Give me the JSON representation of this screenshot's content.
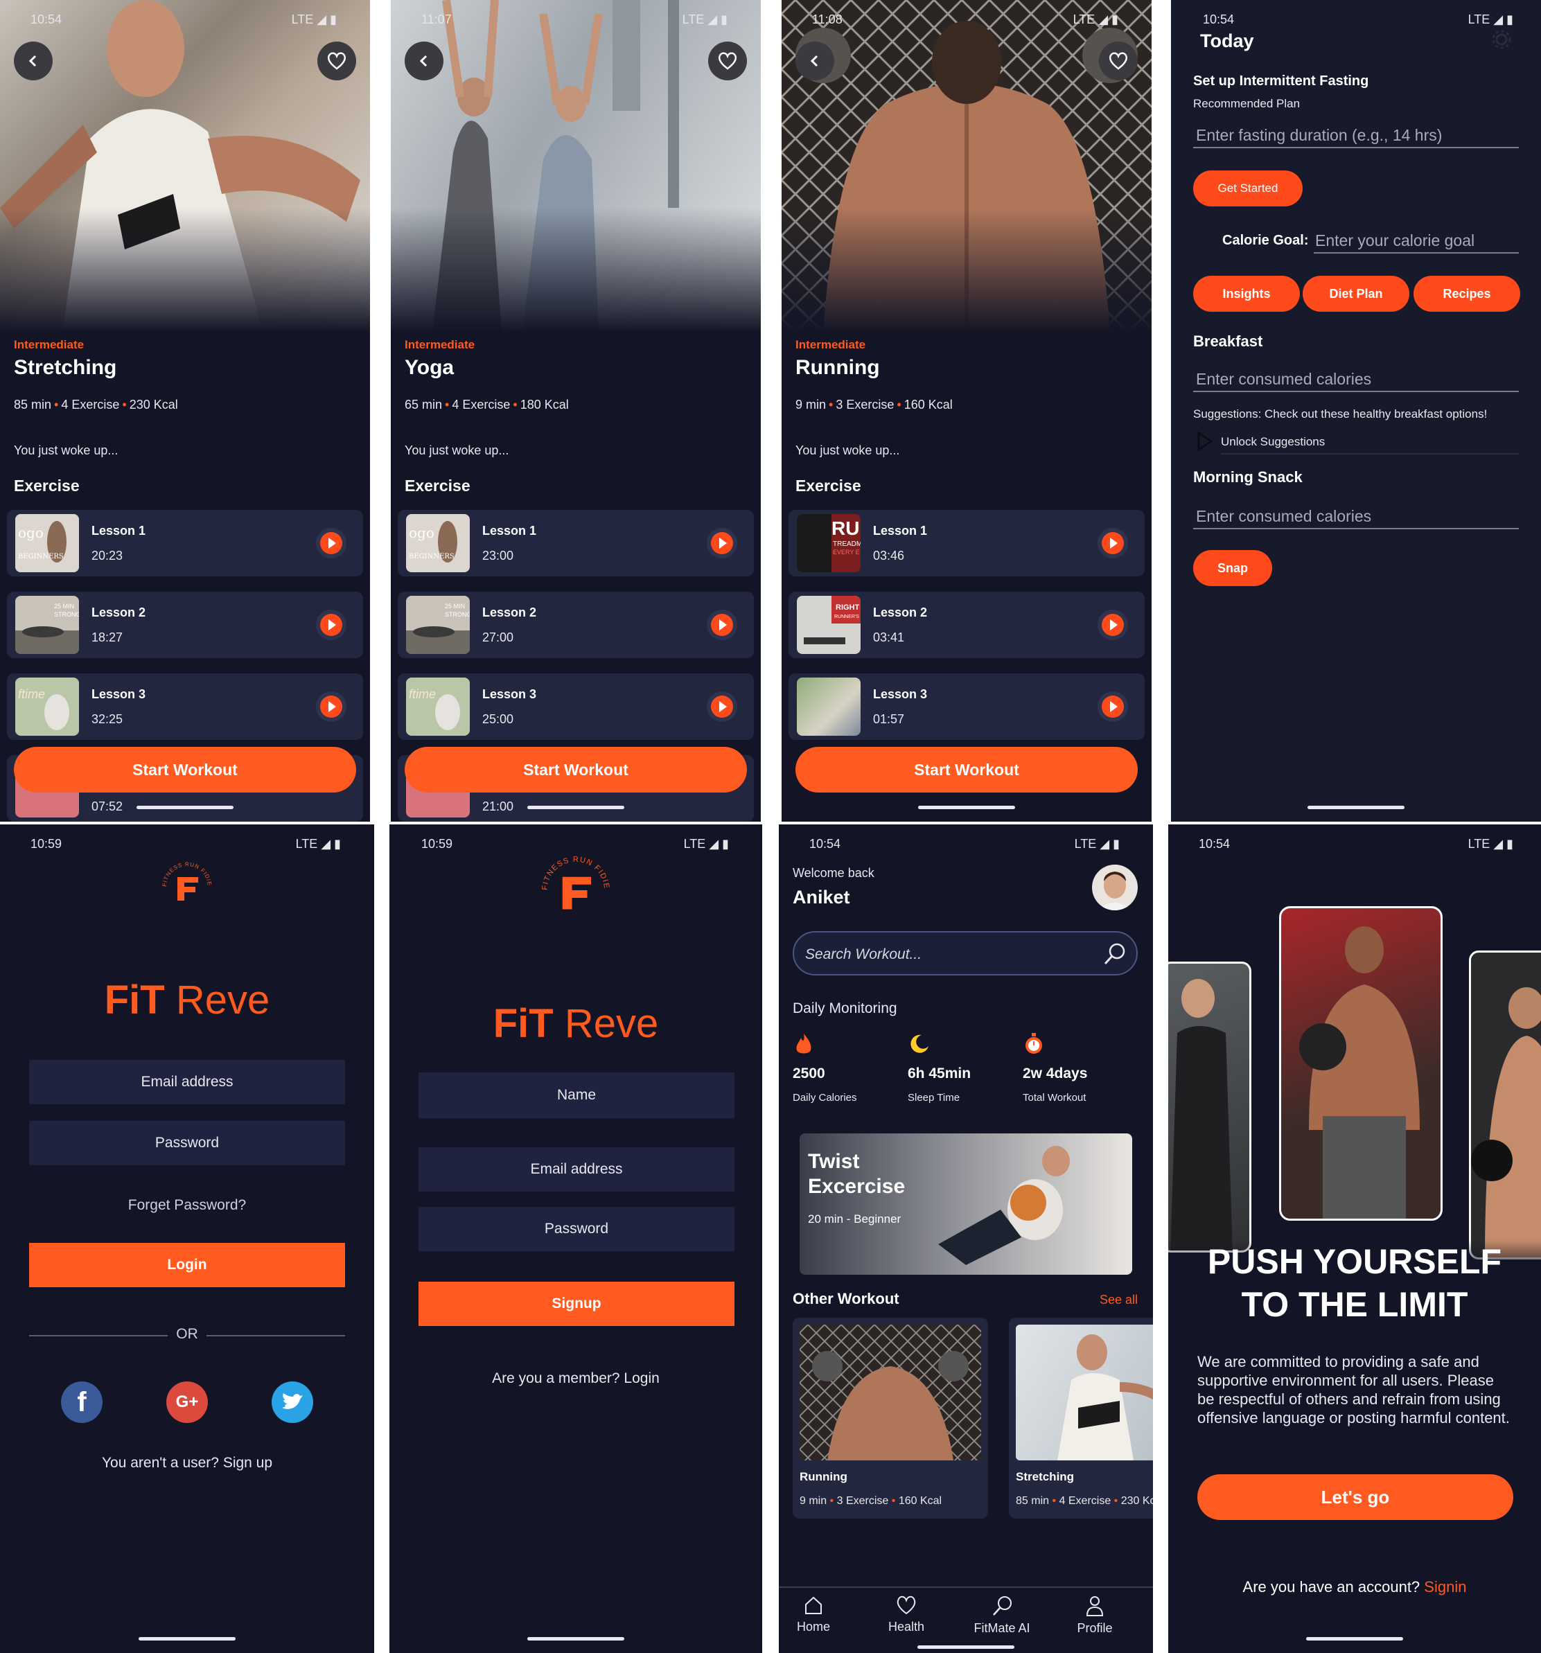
{
  "colors": {
    "accent": "#ff5a1f",
    "background": "#131526",
    "card": "#22263f",
    "input": "#1f2340"
  },
  "workouts": [
    {
      "time": "10:54",
      "network": "LTE",
      "level": "Intermediate",
      "title": "Stretching",
      "duration": "85 min",
      "exercises": "4 Exercise",
      "kcal": "230 Kcal",
      "intro": "You just woke up...",
      "section": "Exercise",
      "lessons": [
        {
          "name": "Lesson 1",
          "time": "20:23"
        },
        {
          "name": "Lesson 2",
          "time": "18:27"
        },
        {
          "name": "Lesson 3",
          "time": "32:25"
        },
        {
          "name": "",
          "time": "07:52"
        }
      ],
      "thumb_texts": [
        "ogo",
        "BEGINNERS",
        "25 MIN",
        "STRONG",
        "ftime"
      ],
      "start": "Start Workout"
    },
    {
      "time": "11:07",
      "network": "LTE",
      "level": "Intermediate",
      "title": "Yoga",
      "duration": "65 min",
      "exercises": "4 Exercise",
      "kcal": "180 Kcal",
      "intro": "You just woke up...",
      "section": "Exercise",
      "lessons": [
        {
          "name": "Lesson 1",
          "time": "23:00"
        },
        {
          "name": "Lesson 2",
          "time": "27:00"
        },
        {
          "name": "Lesson 3",
          "time": "25:00"
        },
        {
          "name": "",
          "time": "21:00"
        }
      ],
      "thumb_texts": [
        "ogo",
        "BEGINNERS",
        "25 MIN",
        "STRONG",
        "ftime"
      ],
      "start": "Start Workout"
    },
    {
      "time": "11:08",
      "network": "LTE",
      "level": "Intermediate",
      "title": "Running",
      "duration": "9 min",
      "exercises": "3 Exercise",
      "kcal": "160 Kcal",
      "intro": "You just woke up...",
      "section": "Exercise",
      "lessons": [
        {
          "name": "Lesson 1",
          "time": "03:46"
        },
        {
          "name": "Lesson 2",
          "time": "03:41"
        },
        {
          "name": "Lesson 3",
          "time": "01:57"
        }
      ],
      "thumb_texts": [
        "RU",
        "TREADM",
        "EVERY E",
        "RIGHT",
        "RUNNER'S"
      ],
      "start": "Start Workout"
    }
  ],
  "fasting": {
    "time": "10:54",
    "network": "LTE",
    "header": "Today",
    "setup_title": "Set up Intermittent Fasting",
    "recommended": "Recommended Plan",
    "duration_placeholder": "Enter fasting duration (e.g., 14 hrs)",
    "get_started": "Get Started",
    "calorie_label": "Calorie Goal:",
    "calorie_placeholder": "Enter your calorie goal",
    "tabs": [
      "Insights",
      "Diet Plan",
      "Recipes"
    ],
    "breakfast": "Breakfast",
    "breakfast_placeholder": "Enter consumed calories",
    "suggestions": "Suggestions: Check out these healthy breakfast options!",
    "unlock": "Unlock Suggestions",
    "snack": "Morning Snack",
    "snack_placeholder": "Enter consumed calories",
    "snap": "Snap"
  },
  "login": {
    "time": "10:59",
    "network": "LTE",
    "logo_ring": "FITNESS RUN FIDIET RUN",
    "app_name_a": "FiT",
    "app_name_b": " Reve",
    "email": "Email address",
    "password": "Password",
    "forgot": "Forget Password?",
    "login": "Login",
    "or": "OR",
    "social": {
      "facebook": "f",
      "google": "G+"
    },
    "signup_prompt": "You aren't a user? Sign up"
  },
  "signup": {
    "time": "10:59",
    "network": "LTE",
    "logo_ring": "FITNESS RUN FIDIET RUN",
    "app_name_a": "FiT",
    "app_name_b": " Reve",
    "name": "Name",
    "email": "Email address",
    "password": "Password",
    "signup": "Signup",
    "login_prompt": "Are you a member? Login"
  },
  "home": {
    "time": "10:54",
    "network": "LTE",
    "welcome": "Welcome back",
    "user": "Aniket",
    "search_placeholder": "Search Workout...",
    "monitoring": "Daily Monitoring",
    "stats": [
      {
        "value": "2500",
        "label": "Daily Calories",
        "icon": "flame-icon"
      },
      {
        "value": "6h 45min",
        "label": "Sleep Time",
        "icon": "moon-icon"
      },
      {
        "value": "2w 4days",
        "label": "Total Workout",
        "icon": "stopwatch-icon"
      }
    ],
    "featured": {
      "title1": "Twist",
      "title2": "Excercise",
      "meta": "20 min - Beginner"
    },
    "other": "Other Workout",
    "see_all": "See all",
    "cards": [
      {
        "name": "Running",
        "duration": "9 min",
        "exercises": "3 Exercise",
        "kcal": "160 Kcal"
      },
      {
        "name": "Stretching",
        "duration": "85 min",
        "exercises": "4 Exercise",
        "kcal": "230 Kcal"
      }
    ],
    "nav": [
      "Home",
      "Health",
      "FitMate AI",
      "Profile"
    ]
  },
  "onboard": {
    "time": "10:54",
    "network": "LTE",
    "headline1": "PUSH YOURSELF",
    "headline2": "TO THE LIMIT",
    "body": "We are committed to providing a safe and supportive environment for all users. Please be  respectful of others and refrain from using offensive language or posting harmful content.",
    "cta": "Let's go",
    "account_prompt": "Are you have an account? ",
    "signin": "Signin"
  }
}
